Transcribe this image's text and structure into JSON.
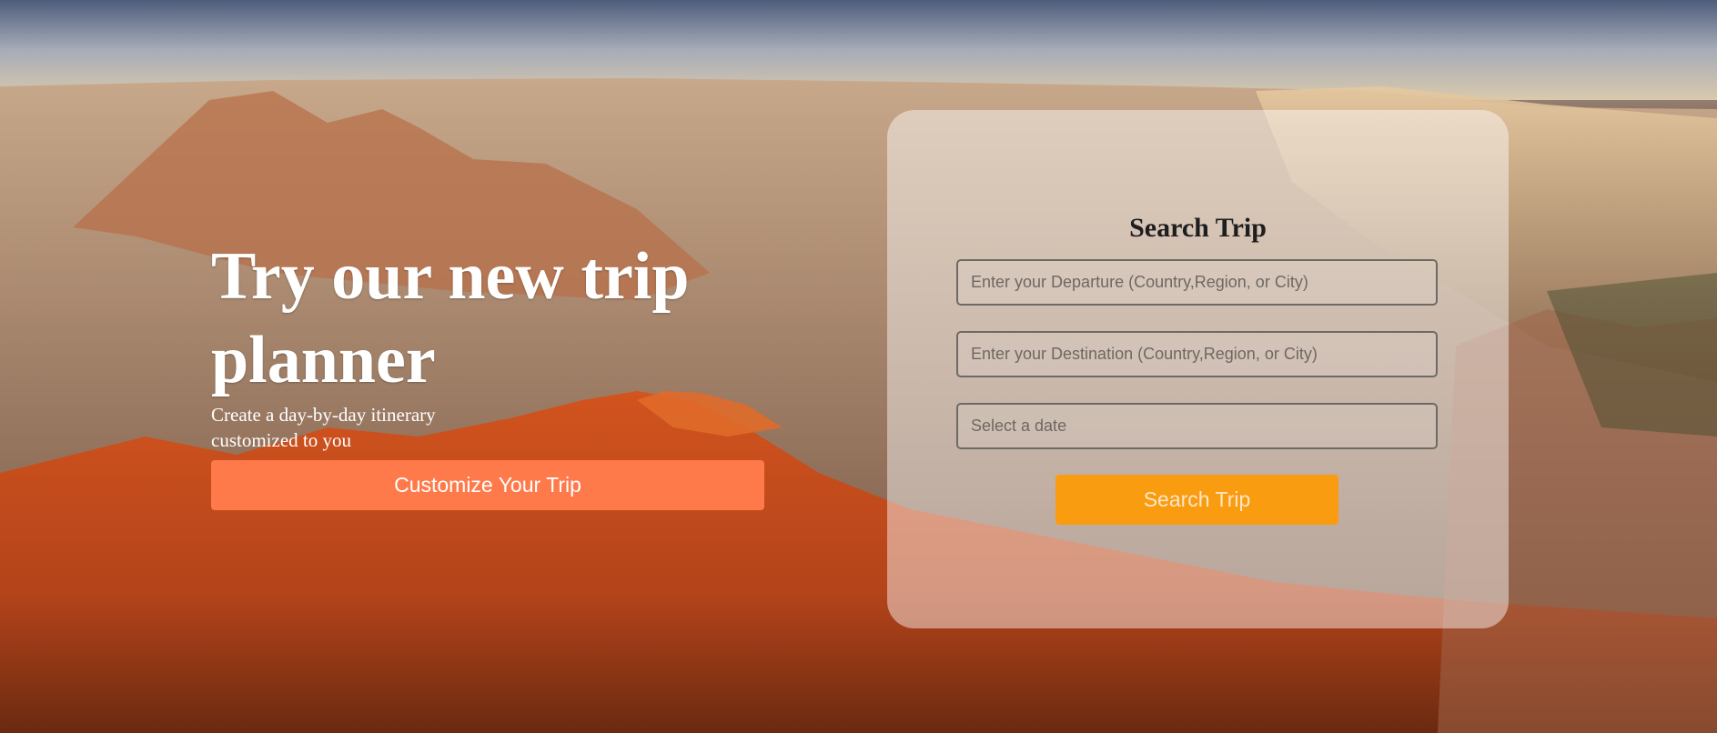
{
  "hero": {
    "title": "Try our new trip planner",
    "subtitle": "Create a day-by-day itinerary customized to you",
    "cta_label": "Customize Your Trip"
  },
  "search_card": {
    "title": "Search Trip",
    "departure_placeholder": "Enter your Departure (Country,Region, or City)",
    "destination_placeholder": "Enter your Destination (Country,Region, or City)",
    "date_placeholder": "Select a date",
    "button_label": "Search Trip"
  },
  "colors": {
    "cta": "#ff7a4a",
    "search_button": "#ff9a00",
    "card_background": "rgba(255,255,255,0.45)"
  }
}
